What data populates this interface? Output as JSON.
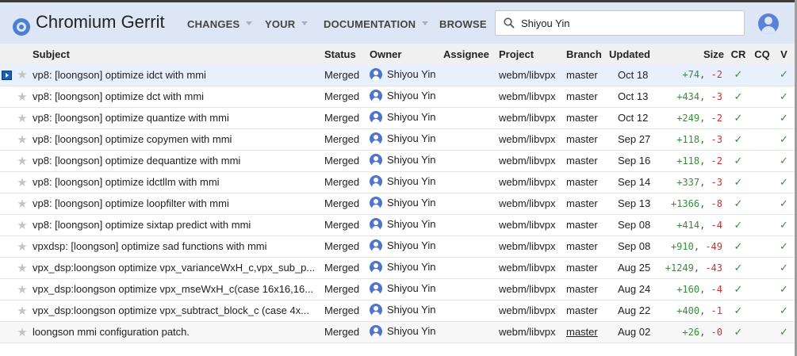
{
  "app": {
    "title": "Chromium Gerrit"
  },
  "nav": [
    {
      "label": "CHANGES",
      "has_menu": true
    },
    {
      "label": "YOUR",
      "has_menu": true
    },
    {
      "label": "DOCUMENTATION",
      "has_menu": true
    },
    {
      "label": "BROWSE",
      "has_menu": false
    }
  ],
  "search": {
    "value": "Shiyou Yin",
    "icon": "search-icon"
  },
  "colors": {
    "header_bg": "#dde6f5",
    "insertions": "#388e3c",
    "deletions": "#d32f2f",
    "approved": "#388e3c",
    "selected_row": "#e8f0fe"
  },
  "table": {
    "headers": {
      "subject": "Subject",
      "status": "Status",
      "owner": "Owner",
      "assignee": "Assignee",
      "project": "Project",
      "branch": "Branch",
      "updated": "Updated",
      "size": "Size",
      "cr": "CR",
      "cq": "CQ",
      "v": "V"
    },
    "rows": [
      {
        "subject": "vp8: [loongson] optimize idct with mmi",
        "status": "Merged",
        "owner": "Shiyou Yin",
        "assignee": "",
        "project": "webm/libvpx",
        "branch": "master",
        "updated": "Oct 18",
        "ins": "+74",
        "del": "-2",
        "cr": "✓",
        "cq": "",
        "v": "✓"
      },
      {
        "subject": "vp8: [loongson] optimize dct with mmi",
        "status": "Merged",
        "owner": "Shiyou Yin",
        "assignee": "",
        "project": "webm/libvpx",
        "branch": "master",
        "updated": "Oct 13",
        "ins": "+434",
        "del": "-3",
        "cr": "✓",
        "cq": "",
        "v": "✓"
      },
      {
        "subject": "vp8: [loongson] optimize quantize with mmi",
        "status": "Merged",
        "owner": "Shiyou Yin",
        "assignee": "",
        "project": "webm/libvpx",
        "branch": "master",
        "updated": "Oct 12",
        "ins": "+249",
        "del": "-2",
        "cr": "✓",
        "cq": "",
        "v": "✓"
      },
      {
        "subject": "vp8: [loongson] optimize copymen with mmi",
        "status": "Merged",
        "owner": "Shiyou Yin",
        "assignee": "",
        "project": "webm/libvpx",
        "branch": "master",
        "updated": "Sep 27",
        "ins": "+118",
        "del": "-3",
        "cr": "✓",
        "cq": "",
        "v": "✓"
      },
      {
        "subject": "vp8: [loongson] optimize dequantize with mmi",
        "status": "Merged",
        "owner": "Shiyou Yin",
        "assignee": "",
        "project": "webm/libvpx",
        "branch": "master",
        "updated": "Sep 16",
        "ins": "+118",
        "del": "-2",
        "cr": "✓",
        "cq": "",
        "v": "✓"
      },
      {
        "subject": "vp8: [loongson] optimize idctllm with mmi",
        "status": "Merged",
        "owner": "Shiyou Yin",
        "assignee": "",
        "project": "webm/libvpx",
        "branch": "master",
        "updated": "Sep 14",
        "ins": "+337",
        "del": "-3",
        "cr": "✓",
        "cq": "",
        "v": "✓"
      },
      {
        "subject": "vp8: [loongson] optimize loopfilter with mmi",
        "status": "Merged",
        "owner": "Shiyou Yin",
        "assignee": "",
        "project": "webm/libvpx",
        "branch": "master",
        "updated": "Sep 13",
        "ins": "+1366",
        "del": "-8",
        "cr": "✓",
        "cq": "",
        "v": "✓"
      },
      {
        "subject": "vp8: [loongson] optimize sixtap predict with mmi",
        "status": "Merged",
        "owner": "Shiyou Yin",
        "assignee": "",
        "project": "webm/libvpx",
        "branch": "master",
        "updated": "Sep 08",
        "ins": "+414",
        "del": "-4",
        "cr": "✓",
        "cq": "",
        "v": "✓"
      },
      {
        "subject": "vpxdsp: [loongson] optimize sad functions with mmi",
        "status": "Merged",
        "owner": "Shiyou Yin",
        "assignee": "",
        "project": "webm/libvpx",
        "branch": "master",
        "updated": "Sep 08",
        "ins": "+910",
        "del": "-49",
        "cr": "✓",
        "cq": "",
        "v": "✓"
      },
      {
        "subject": "vpx_dsp:loongson optimize vpx_varianceWxH_c,vpx_sub_p...",
        "status": "Merged",
        "owner": "Shiyou Yin",
        "assignee": "",
        "project": "webm/libvpx",
        "branch": "master",
        "updated": "Aug 25",
        "ins": "+1249",
        "del": "-43",
        "cr": "✓",
        "cq": "",
        "v": "✓"
      },
      {
        "subject": "vpx_dsp:loongson optimize vpx_mseWxH_c(case 16x16,16...",
        "status": "Merged",
        "owner": "Shiyou Yin",
        "assignee": "",
        "project": "webm/libvpx",
        "branch": "master",
        "updated": "Aug 24",
        "ins": "+160",
        "del": "-4",
        "cr": "✓",
        "cq": "",
        "v": "✓"
      },
      {
        "subject": "vpx_dsp:loongson optimize vpx_subtract_block_c (case 4x...",
        "status": "Merged",
        "owner": "Shiyou Yin",
        "assignee": "",
        "project": "webm/libvpx",
        "branch": "master",
        "updated": "Aug 22",
        "ins": "+400",
        "del": "-1",
        "cr": "✓",
        "cq": "",
        "v": "✓"
      },
      {
        "subject": "loongson mmi configuration patch.",
        "status": "Merged",
        "owner": "Shiyou Yin",
        "assignee": "",
        "project": "webm/libvpx",
        "branch": "master",
        "updated": "Aug 02",
        "ins": "+26",
        "del": "-0",
        "cr": "✓",
        "cq": "",
        "v": "✓"
      }
    ]
  }
}
